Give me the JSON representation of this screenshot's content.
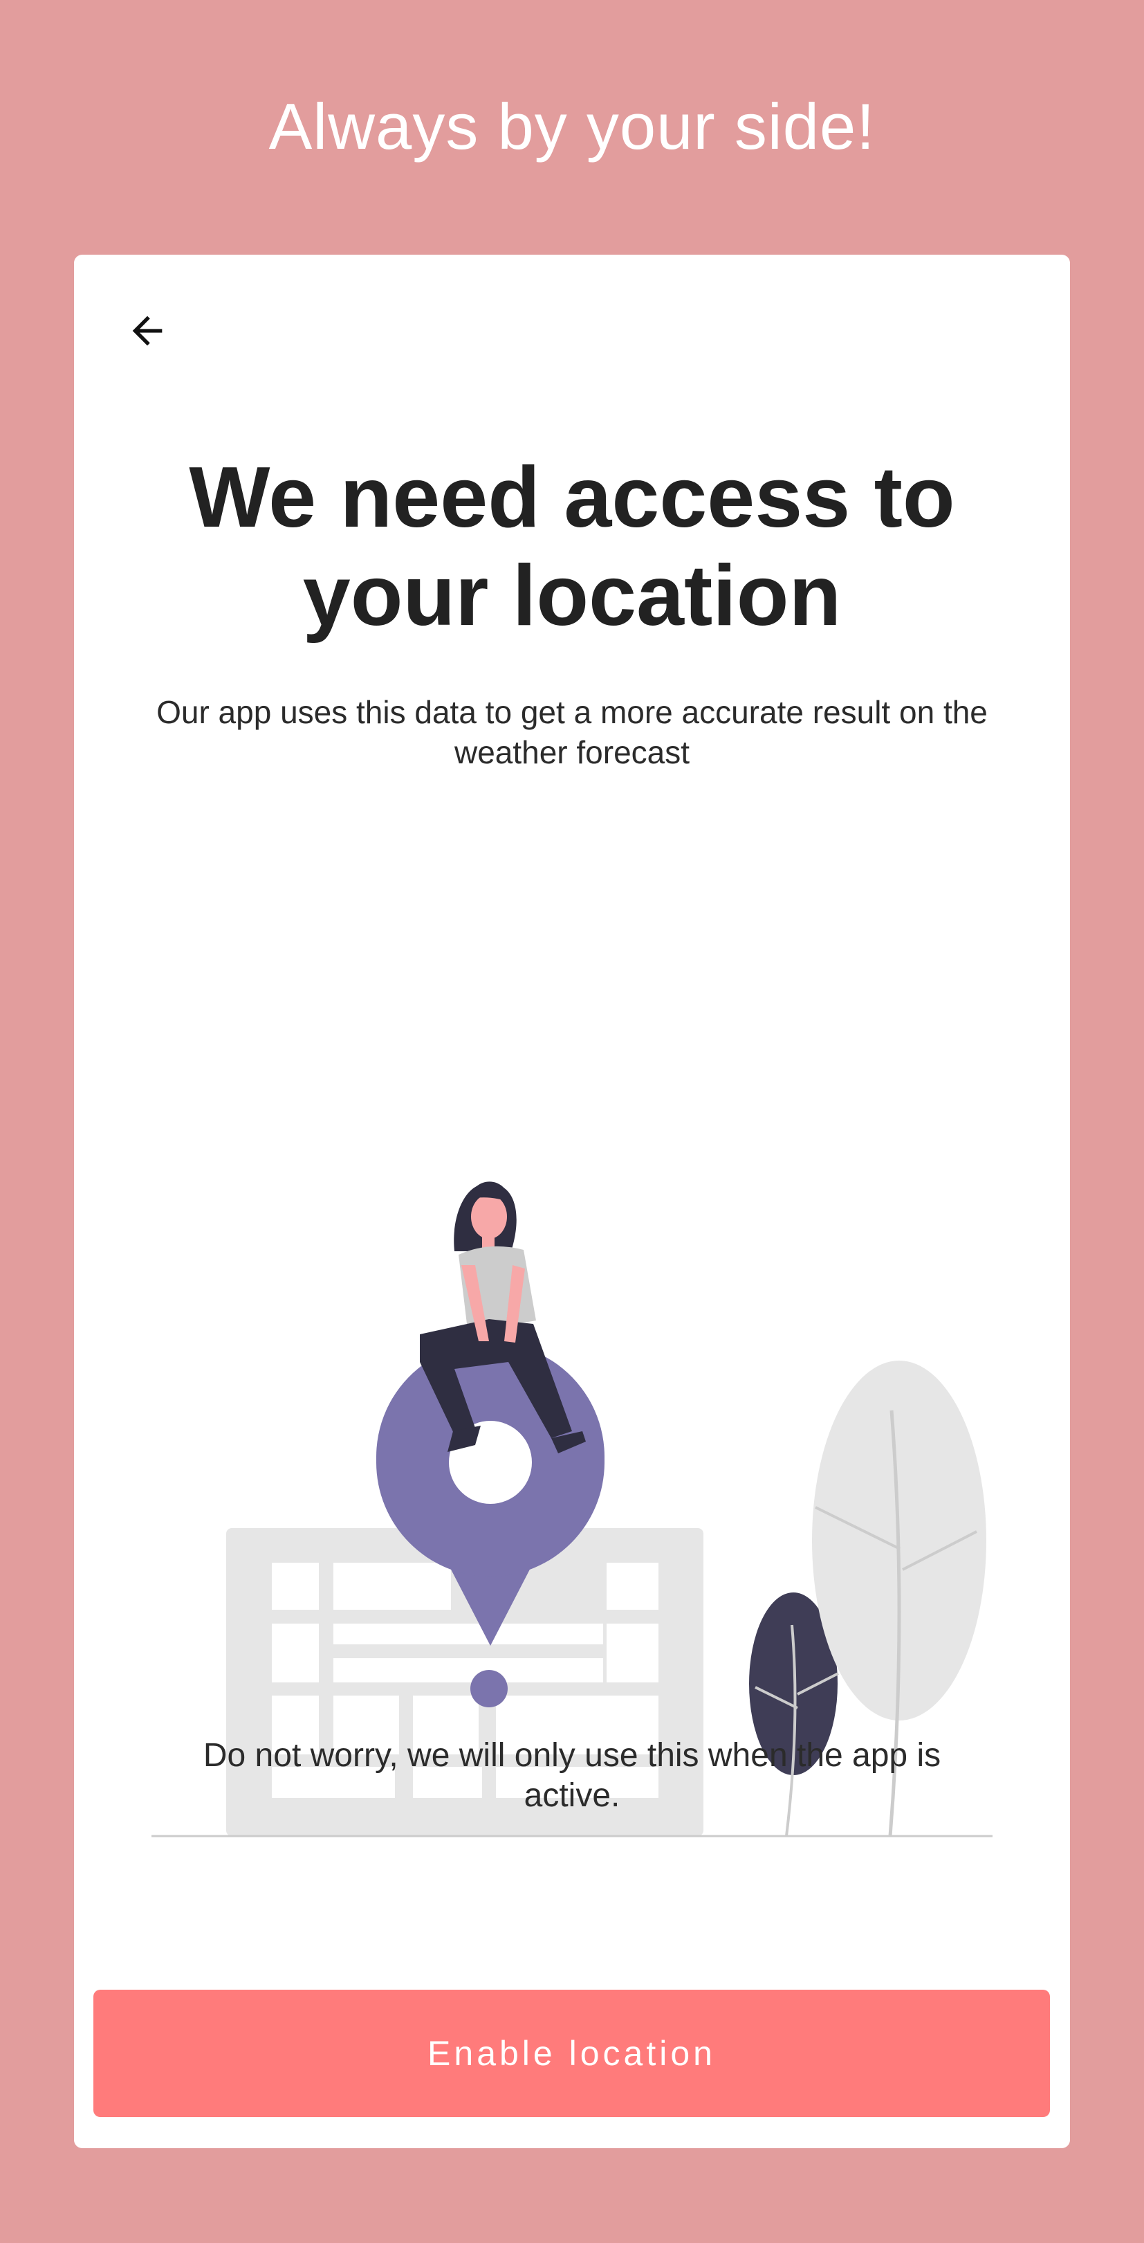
{
  "header": {
    "title": "Always by your side!"
  },
  "card": {
    "back_icon": "arrow-left-icon",
    "heading": "We need access to your location",
    "subtitle": "Our app uses this data to get a more accurate result on the weather forecast",
    "note": "Do not worry, we will only use this when the app is active.",
    "cta_label": "Enable location"
  },
  "colors": {
    "background": "#e29d9d",
    "card": "#ffffff",
    "accent": "#ff7b7b",
    "pin": "#7b74ad",
    "dark": "#3f3d56",
    "light_gray": "#e6e6e6"
  }
}
